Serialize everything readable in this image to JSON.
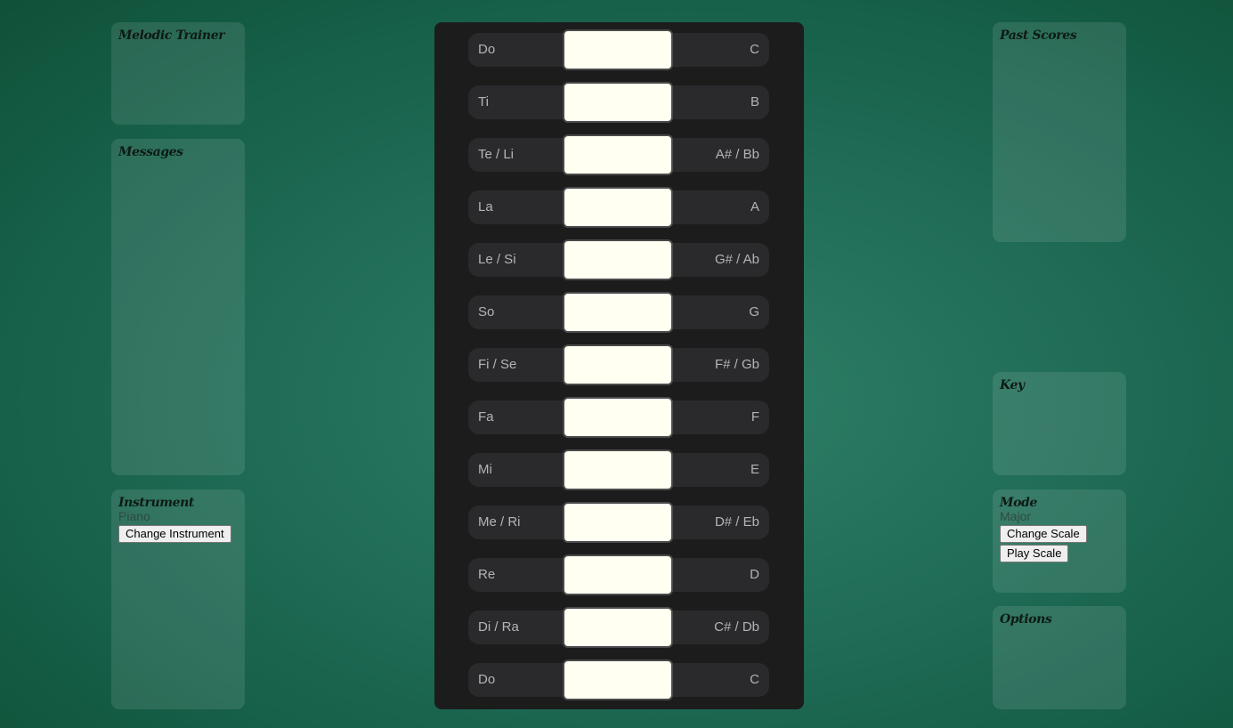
{
  "left_panels": {
    "trainer_title": "Melodic Trainer",
    "messages_title": "Messages",
    "instrument_title": "Instrument",
    "instrument_value": "Piano",
    "change_instrument_label": "Change Instrument"
  },
  "right_panels": {
    "past_scores_title": "Past Scores",
    "key_title": "Key",
    "mode_title": "Mode",
    "mode_value": "Major",
    "change_scale_label": "Change Scale",
    "play_scale_label": "Play Scale",
    "options_title": "Options"
  },
  "notes": [
    {
      "solfege": "Do",
      "letter": "C"
    },
    {
      "solfege": "Ti",
      "letter": "B"
    },
    {
      "solfege": "Te / Li",
      "letter": "A# / Bb"
    },
    {
      "solfege": "La",
      "letter": "A"
    },
    {
      "solfege": "Le / Si",
      "letter": "G# / Ab"
    },
    {
      "solfege": "So",
      "letter": "G"
    },
    {
      "solfege": "Fi / Se",
      "letter": "F# / Gb"
    },
    {
      "solfege": "Fa",
      "letter": "F"
    },
    {
      "solfege": "Mi",
      "letter": "E"
    },
    {
      "solfege": "Me / Ri",
      "letter": "D# / Eb"
    },
    {
      "solfege": "Re",
      "letter": "D"
    },
    {
      "solfege": "Di / Ra",
      "letter": "C# / Db"
    },
    {
      "solfege": "Do",
      "letter": "C"
    }
  ]
}
